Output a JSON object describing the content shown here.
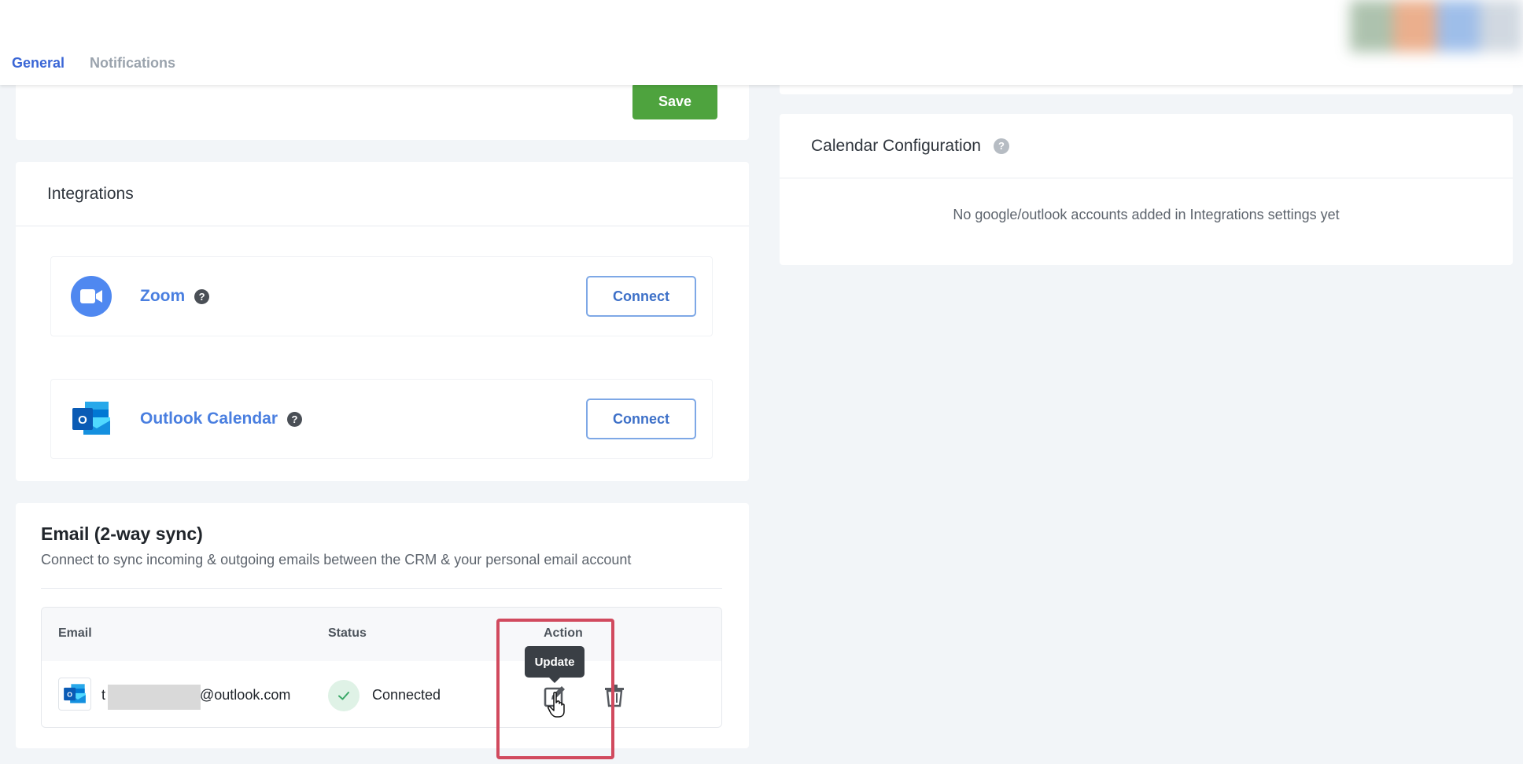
{
  "header": {
    "tabs": [
      {
        "label": "General",
        "active": true
      },
      {
        "label": "Notifications",
        "active": false
      }
    ]
  },
  "top_card": {
    "save_label": "Save"
  },
  "integrations": {
    "title": "Integrations",
    "items": [
      {
        "name": "Zoom",
        "icon": "zoom-icon",
        "connect_label": "Connect"
      },
      {
        "name": "Outlook Calendar",
        "icon": "outlook-icon",
        "connect_label": "Connect"
      }
    ]
  },
  "calendar_config": {
    "title": "Calendar Configuration",
    "empty_message": "No google/outlook accounts added in Integrations settings yet"
  },
  "email_sync": {
    "title": "Email (2-way sync)",
    "subtitle": "Connect to sync incoming & outgoing emails between the CRM & your personal email account",
    "columns": {
      "email": "Email",
      "status": "Status",
      "action": "Action"
    },
    "rows": [
      {
        "email_prefix": "t",
        "email_suffix": "@outlook.com",
        "status": "Connected"
      }
    ],
    "tooltip": "Update"
  },
  "colors": {
    "accent": "#3a66d6",
    "save": "#4ea33e",
    "highlight": "#d14a5e",
    "connected": "#dff2e6"
  }
}
